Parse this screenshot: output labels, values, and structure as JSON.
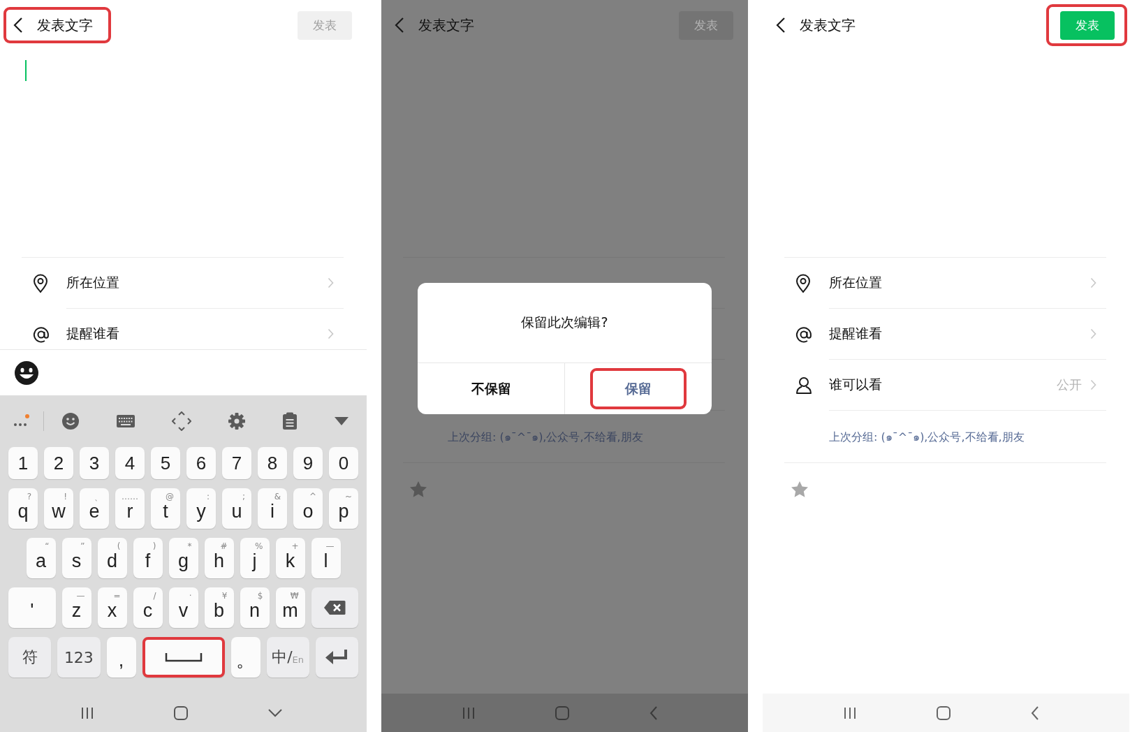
{
  "screens": [
    {
      "kind": "keyboard",
      "dimmed": false,
      "header": {
        "title": "发表文字",
        "post_label": "发表",
        "post_enabled": false,
        "back_highlighted": true,
        "post_highlighted": false
      },
      "cursor": true,
      "options": [
        {
          "kind": "location",
          "label": "所在位置"
        },
        {
          "kind": "mention",
          "label": "提醒谁看"
        }
      ],
      "keyboard": {
        "rows": [
          {
            "keys": [
              {
                "kind": "digit",
                "label": "1",
                "highlighted": false
              },
              {
                "kind": "digit",
                "label": "2",
                "highlighted": false
              },
              {
                "kind": "digit",
                "label": "3",
                "highlighted": false
              },
              {
                "kind": "digit",
                "label": "4",
                "highlighted": false
              },
              {
                "kind": "digit",
                "label": "5",
                "highlighted": false
              },
              {
                "kind": "digit",
                "label": "6",
                "highlighted": false
              },
              {
                "kind": "digit",
                "label": "7",
                "highlighted": false
              },
              {
                "kind": "digit",
                "label": "8",
                "highlighted": false
              },
              {
                "kind": "digit",
                "label": "9",
                "highlighted": false
              },
              {
                "kind": "digit",
                "label": "0",
                "highlighted": false
              }
            ]
          },
          {
            "keys": [
              {
                "kind": "letter",
                "label": "q",
                "hint": "?",
                "highlighted": false
              },
              {
                "kind": "letter",
                "label": "w",
                "hint": "!",
                "highlighted": false
              },
              {
                "kind": "letter",
                "label": "e",
                "hint": "、",
                "highlighted": false
              },
              {
                "kind": "letter",
                "label": "r",
                "hint": "……",
                "highlighted": false
              },
              {
                "kind": "letter",
                "label": "t",
                "hint": "@",
                "highlighted": false
              },
              {
                "kind": "letter",
                "label": "y",
                "hint": ":",
                "highlighted": false
              },
              {
                "kind": "letter",
                "label": "u",
                "hint": ";",
                "highlighted": false
              },
              {
                "kind": "letter",
                "label": "i",
                "hint": "&",
                "highlighted": false
              },
              {
                "kind": "letter",
                "label": "o",
                "hint": "^",
                "highlighted": false
              },
              {
                "kind": "letter",
                "label": "p",
                "hint": "~",
                "highlighted": false
              }
            ]
          },
          {
            "keys": [
              {
                "kind": "letter",
                "label": "a",
                "hint": "“",
                "highlighted": false
              },
              {
                "kind": "letter",
                "label": "s",
                "hint": "”",
                "highlighted": false
              },
              {
                "kind": "letter",
                "label": "d",
                "hint": "(",
                "highlighted": false
              },
              {
                "kind": "letter",
                "label": "f",
                "hint": ")",
                "highlighted": false
              },
              {
                "kind": "letter",
                "label": "g",
                "hint": "*",
                "highlighted": false
              },
              {
                "kind": "letter",
                "label": "h",
                "hint": "#",
                "highlighted": false
              },
              {
                "kind": "letter",
                "label": "j",
                "hint": "%",
                "highlighted": false
              },
              {
                "kind": "letter",
                "label": "k",
                "hint": "+",
                "highlighted": false
              },
              {
                "kind": "letter",
                "label": "l",
                "hint": "—",
                "highlighted": false
              }
            ]
          },
          {
            "keys": [
              {
                "kind": "wide",
                "label": "'",
                "highlighted": false
              },
              {
                "kind": "letter",
                "label": "z",
                "hint": "—",
                "highlighted": false
              },
              {
                "kind": "letter",
                "label": "x",
                "hint": "=",
                "highlighted": false
              },
              {
                "kind": "letter",
                "label": "c",
                "hint": "/",
                "highlighted": false
              },
              {
                "kind": "letter",
                "label": "v",
                "hint": "·",
                "highlighted": false
              },
              {
                "kind": "letter",
                "label": "b",
                "hint": "¥",
                "highlighted": false
              },
              {
                "kind": "letter",
                "label": "n",
                "hint": "$",
                "highlighted": false
              },
              {
                "kind": "letter",
                "label": "m",
                "hint": "₩",
                "highlighted": false
              },
              {
                "kind": "backspace",
                "highlighted": false
              }
            ]
          },
          {
            "keys": [
              {
                "kind": "func",
                "label": "符",
                "highlighted": false
              },
              {
                "kind": "func",
                "label": "123",
                "highlighted": false
              },
              {
                "kind": "letter",
                "label": ",",
                "highlighted": false
              },
              {
                "kind": "space",
                "highlighted": true
              },
              {
                "kind": "letter",
                "label": "。",
                "highlighted": false
              },
              {
                "kind": "func",
                "label": "中/",
                "sublabel": "En",
                "highlighted": false
              },
              {
                "kind": "enter",
                "highlighted": false
              }
            ]
          }
        ]
      }
    },
    {
      "kind": "dialog",
      "dimmed": true,
      "header": {
        "title": "发表文字",
        "post_label": "发表",
        "post_enabled": false,
        "back_highlighted": false,
        "post_highlighted": false
      },
      "group_note": "上次分组: (๑¯^¯๑),公众号,不给看,朋友",
      "dialog": {
        "message": "保留此次编辑?",
        "buttons": [
          {
            "label": "不保留",
            "primary": false,
            "highlighted": false
          },
          {
            "label": "保留",
            "primary": true,
            "highlighted": true
          }
        ]
      }
    },
    {
      "kind": "ready",
      "dimmed": false,
      "header": {
        "title": "发表文字",
        "post_label": "发表",
        "post_enabled": true,
        "back_highlighted": false,
        "post_highlighted": true
      },
      "options": [
        {
          "kind": "location",
          "label": "所在位置"
        },
        {
          "kind": "mention",
          "label": "提醒谁看"
        },
        {
          "kind": "audience",
          "label": "谁可以看",
          "value": "公开"
        }
      ],
      "group_note": "上次分组: (๑¯^¯๑),公众号,不给看,朋友"
    }
  ]
}
